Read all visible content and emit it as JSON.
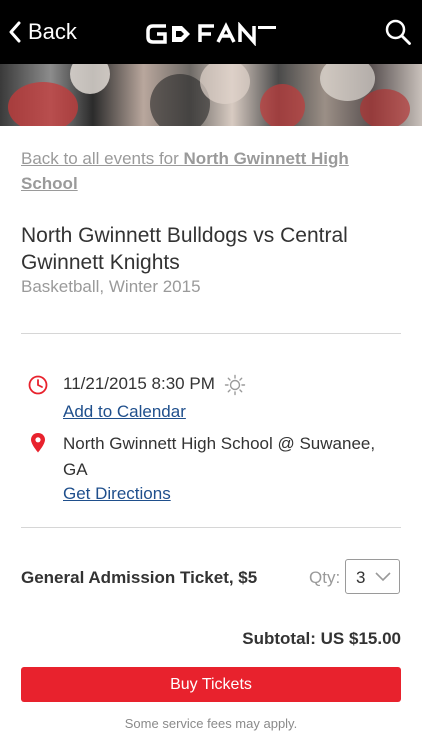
{
  "nav": {
    "back_label": "Back",
    "logo_text": "GOFAN",
    "search_icon": "search-icon",
    "back_icon": "chevron-left-icon"
  },
  "event": {
    "back_link_prefix": "Back to all events for ",
    "back_link_school": "North Gwinnett High School",
    "title": "North Gwinnett Bulldogs vs Central Gwinnett Knights",
    "subtitle": "Basketball, Winter 2015",
    "datetime": "11/21/2015 8:30 PM",
    "weather_icon": "sun-icon",
    "add_calendar_label": "Add to Calendar",
    "location": "North Gwinnett High School @ Suwanee, GA",
    "directions_label": "Get Directions"
  },
  "ticket": {
    "name": "General Admission Ticket, $5",
    "qty_label": "Qty:",
    "qty_value": "3",
    "subtotal": "Subtotal: US $15.00",
    "buy_label": "Buy Tickets",
    "fees_note": "Some service fees may apply."
  },
  "colors": {
    "accent_red": "#e8222d",
    "link_blue": "#1f4f8c",
    "muted_gray": "#9a9a9a"
  }
}
